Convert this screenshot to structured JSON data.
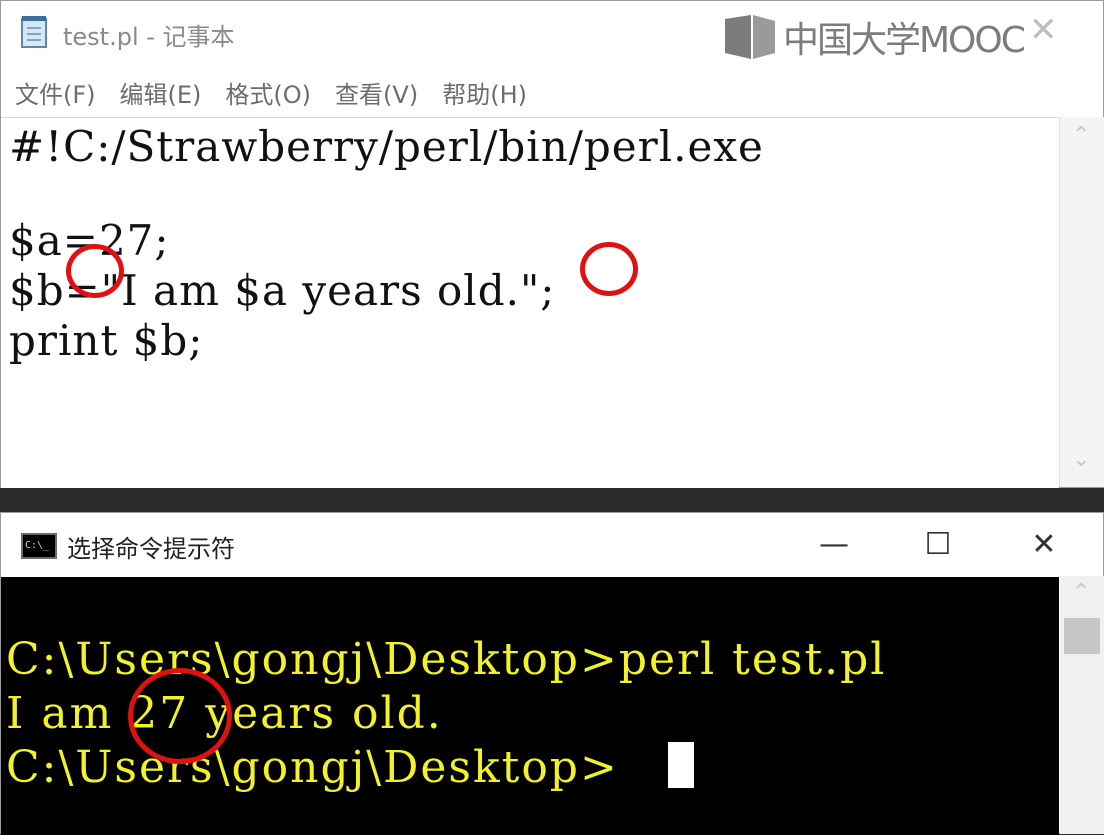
{
  "notepad": {
    "title": "test.pl - 记事本",
    "close_glyph": "✕",
    "watermark_text": "中国大学MOOC",
    "menu": [
      "文件(F)",
      "编辑(E)",
      "格式(O)",
      "查看(V)",
      "帮助(H)"
    ],
    "code_lines": [
      "#!C:/Strawberry/perl/bin/perl.exe",
      "",
      "$a=27;",
      "$b=\"I am $a years old.\";",
      "print $b;"
    ],
    "scroll_up_glyph": "⌃",
    "scroll_down_glyph": "⌄"
  },
  "console": {
    "title": "选择命令提示符",
    "minimize_glyph": "—",
    "maximize_glyph": "☐",
    "close_glyph": "✕",
    "lines": [
      "C:\\Users\\gongj\\Desktop>perl test.pl",
      "I am 27 years old.",
      "C:\\Users\\gongj\\Desktop>"
    ],
    "scroll_up_glyph": "⌃"
  },
  "colors": {
    "annotation_circle": "#e0110f",
    "console_text": "#f2f226",
    "console_background": "#000000"
  }
}
